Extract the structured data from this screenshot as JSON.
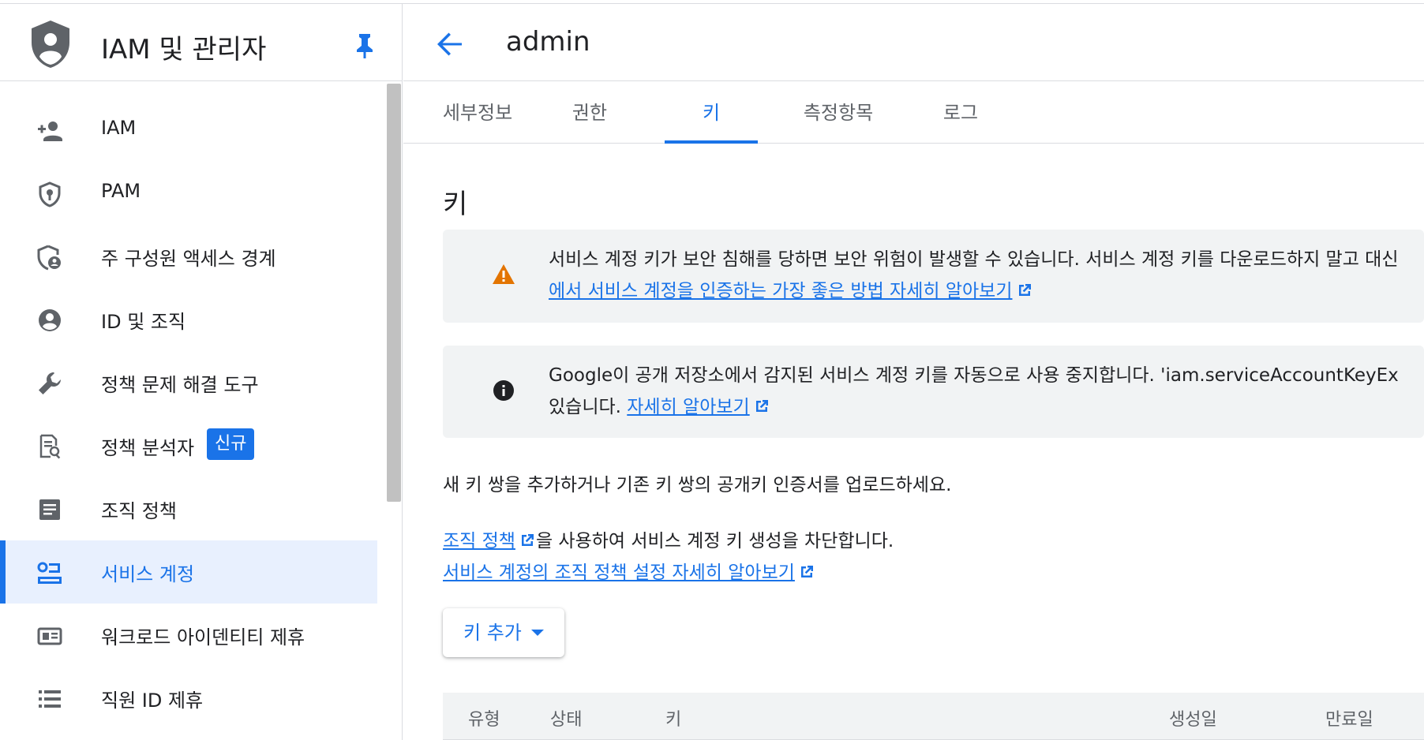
{
  "sidebar": {
    "title": "IAM 및 관리자",
    "items": [
      {
        "label": "IAM",
        "icon": "person-add-icon"
      },
      {
        "label": "PAM",
        "icon": "shield-key-icon"
      },
      {
        "label": "주 구성원 액세스 경계",
        "icon": "shield-person-icon"
      },
      {
        "label": "ID 및 조직",
        "icon": "account-circle-icon"
      },
      {
        "label": "정책 문제 해결 도구",
        "icon": "wrench-icon"
      },
      {
        "label": "정책 분석자",
        "icon": "document-search-icon",
        "badge": "신규"
      },
      {
        "label": "조직 정책",
        "icon": "list-box-icon"
      },
      {
        "label": "서비스 계정",
        "icon": "service-account-icon",
        "active": true
      },
      {
        "label": "워크로드 아이덴티티 제휴",
        "icon": "id-card-icon"
      },
      {
        "label": "직원 ID 제휴",
        "icon": "list-icon"
      }
    ]
  },
  "header": {
    "title": "admin"
  },
  "tabs": [
    {
      "label": "세부정보"
    },
    {
      "label": "권한"
    },
    {
      "label": "키",
      "active": true
    },
    {
      "label": "측정항목"
    },
    {
      "label": "로그"
    }
  ],
  "section": {
    "title": "키"
  },
  "warning": {
    "line1": "서비스 계정 키가 보안 침해를 당하면 보안 위험이 발생할 수 있습니다. 서비스 계정 키를 다운로드하지 말고 대신",
    "link": "에서 서비스 계정을 인증하는 가장 좋은 방법 자세히 알아보기"
  },
  "info": {
    "line1": "Google이 공개 저장소에서 감지된 서비스 계정 키를 자동으로 사용 중지합니다. 'iam.serviceAccountKeyEx",
    "line2_prefix": "있습니다.",
    "link": "자세히 알아보기"
  },
  "description": "새 키 쌍을 추가하거나 기존 키 쌍의 공개키 인증서를 업로드하세요.",
  "org_policy": {
    "link": "조직 정책",
    "suffix": "을 사용하여 서비스 계정 키 생성을 차단합니다.",
    "learn_link": "서비스 계정의 조직 정책 설정 자세히 알아보기"
  },
  "add_key_button": "키 추가",
  "table": {
    "columns": [
      "유형",
      "상태",
      "키",
      "생성일",
      "만료일"
    ]
  },
  "colors": {
    "accent": "#1a73e8",
    "warning": "#e37400"
  }
}
